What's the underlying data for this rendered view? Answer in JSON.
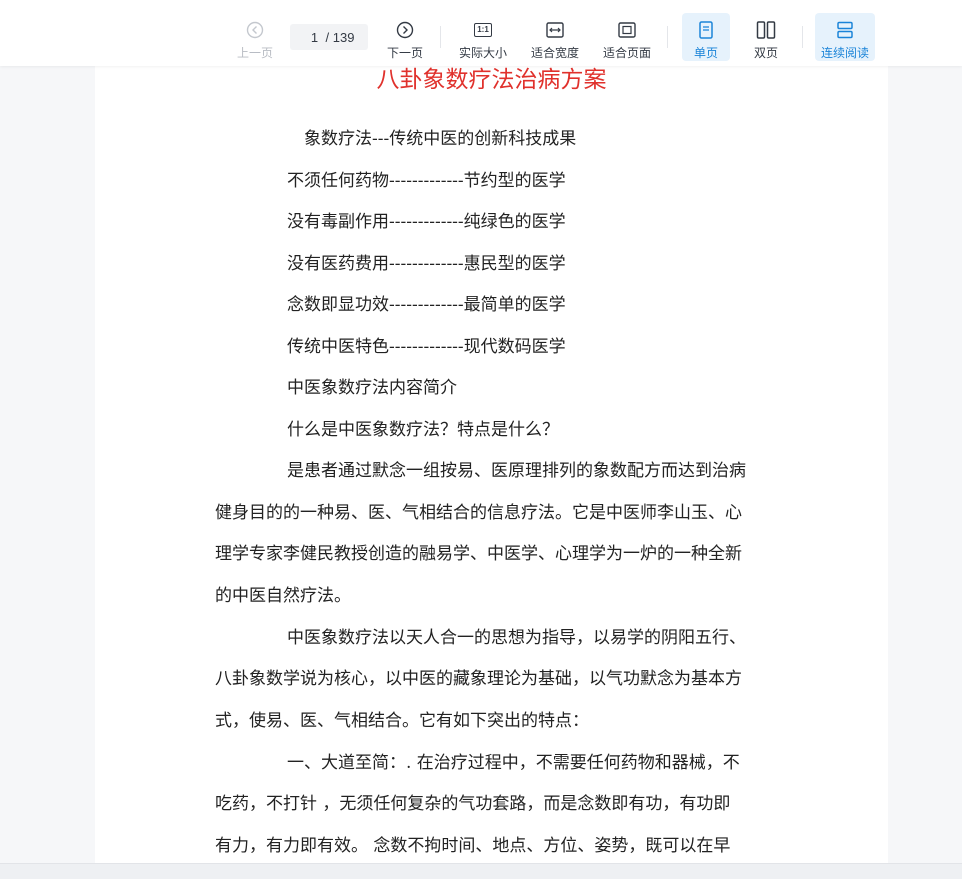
{
  "toolbar": {
    "prev_label": "上一页",
    "current_page": "1",
    "total_pages": "/ 139",
    "next_label": "下一页",
    "actual_size_label": "实际大小",
    "actual_size_icon_text": "1:1",
    "fit_width_label": "适合宽度",
    "fit_page_label": "适合页面",
    "single_page_label": "单页",
    "double_page_label": "双页",
    "continuous_label": "连续阅读",
    "accent_color": "#1b84d8"
  },
  "document": {
    "title": "八卦象数疗法治病方案",
    "lines": [
      "象数疗法---传统中医的创新科技成果",
      "不须任何药物-------------节约型的医学",
      "没有毒副作用-------------纯绿色的医学",
      "没有医药费用-------------惠民型的医学",
      "念数即显功效-------------最简单的医学",
      "传统中医特色-------------现代数码医学",
      "中医象数疗法内容简介",
      "什么是中医象数疗法？特点是什么？",
      "是患者通过默念一组按易、医原理排列的象数配方而达到治病",
      "健身目的的一种易、医、气相结合的信息疗法。它是中医师李山玉、心",
      "理学专家李健民教授创造的融易学、中医学、心理学为一炉的一种全新",
      "的中医自然疗法。",
      "中医象数疗法以天人合一的思想为指导，以易学的阴阳五行、",
      "八卦象数学说为核心，以中医的藏象理论为基础，以气功默念为基本方",
      "式，使易、医、气相结合。它有如下突出的特点：",
      "一、大道至简：. 在治疗过程中，不需要任何药物和器械，不",
      "吃药，不打针 ，无须任何复杂的气功套路，而是念数即有功，有功即",
      "有力，有力即有效。 念数不拘时间、地点、方位、姿势，既可以在早"
    ]
  }
}
